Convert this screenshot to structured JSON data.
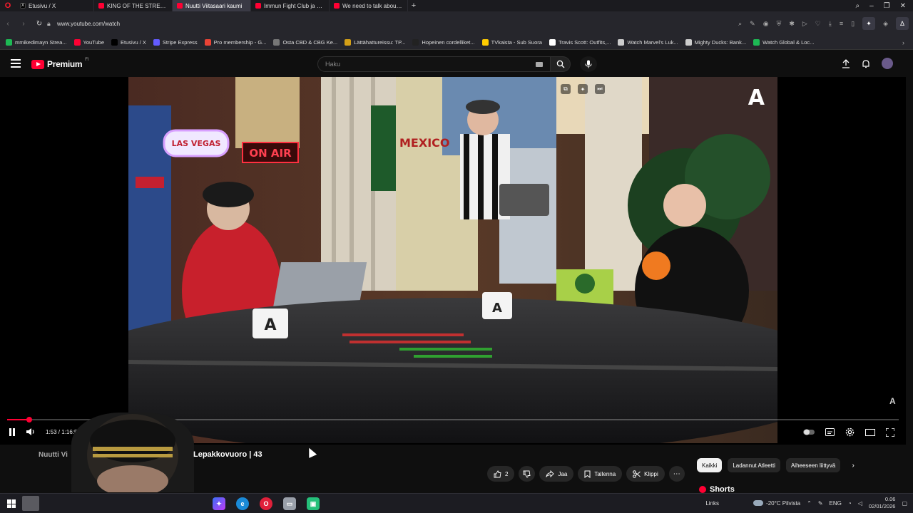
{
  "browser": {
    "tabs": [
      {
        "label": "Etusivu / X",
        "favicon": "x-icon",
        "active": false
      },
      {
        "label": "KING OF THE STREETS - Yo",
        "favicon": "youtube-icon",
        "active": false
      },
      {
        "label": "Nuutti Viitasaari kaumi",
        "favicon": "youtube-icon",
        "active": true
      },
      {
        "label": "Immun Fight Club ja valm",
        "favicon": "youtube-icon",
        "active": false
      },
      {
        "label": "We need to talk about this",
        "favicon": "youtube-icon",
        "active": false
      }
    ],
    "url": "www.youtube.com/watch",
    "bookmarks": [
      {
        "label": "mmikedimayn Strea...",
        "color": "#1db954"
      },
      {
        "label": "YouTube",
        "color": "#ff0033"
      },
      {
        "label": "Etusivu / X",
        "color": "#000000"
      },
      {
        "label": "Stripe Express",
        "color": "#635bff"
      },
      {
        "label": "Pro membership - G...",
        "color": "#ea4335"
      },
      {
        "label": "Osta CBD & CBG Ke...",
        "color": "#777777"
      },
      {
        "label": "Lättähattureissu: TP...",
        "color": "#d4a017"
      },
      {
        "label": "Hopeinen cordelliket...",
        "color": "#222222"
      },
      {
        "label": "TVkaista - Sub Suora",
        "color": "#ffcc00"
      },
      {
        "label": "Travis Scott: Outfits,...",
        "color": "#ffffff"
      },
      {
        "label": "Watch Marvel's Luk...",
        "color": "#cccccc"
      },
      {
        "label": "Mighty Ducks: Bank...",
        "color": "#cccccc"
      },
      {
        "label": "Watch Global & Loc...",
        "color": "#1db954"
      }
    ]
  },
  "youtube": {
    "logo_text": "Premium",
    "country": "FI",
    "search_placeholder": "Haku",
    "accent": "#ff0033"
  },
  "player": {
    "time_label": "1:53 / 1:16:52",
    "progress_fraction": 0.025,
    "watermark": "A",
    "corner_logo": "A"
  },
  "video": {
    "title": "Lepakkovuoro | 43",
    "channel": "Nuutti Vi",
    "likes": "2",
    "share_label": "Jaa",
    "save_label": "Tallenna",
    "clip_label": "Klippi"
  },
  "sidebar": {
    "chips": [
      "Kaikki",
      "Ladannut Atleetti",
      "Aiheeseen liittyvä"
    ],
    "shorts_label": "Shorts"
  },
  "taskbar": {
    "links_label": "Links",
    "weather": "-20°C Pilvista",
    "language": "ENG",
    "time": "0.06",
    "date": "02/01/2026"
  },
  "scene": {
    "sign_vegas": "LAS VEGAS",
    "sign_onair": "ON AIR",
    "poster_mexico": "MEXICO",
    "mug_logo": "A"
  }
}
